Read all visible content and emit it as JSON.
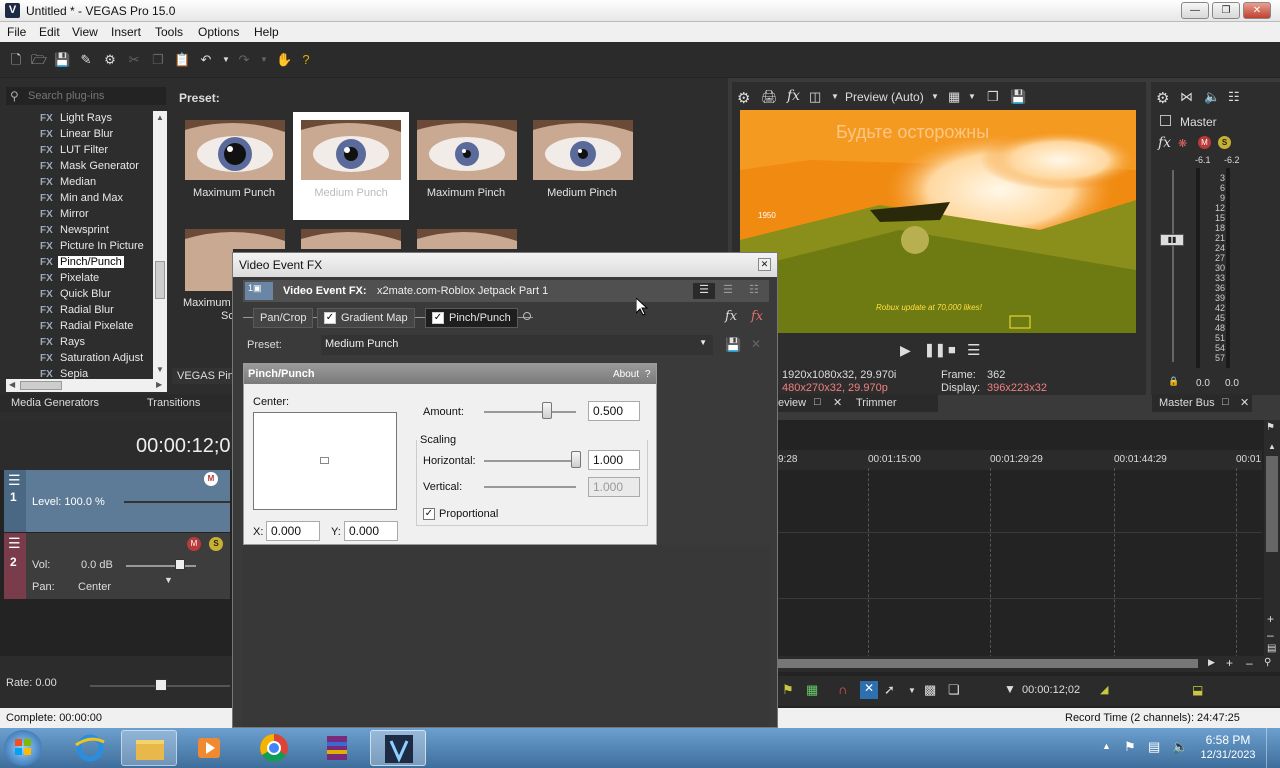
{
  "window": {
    "title": "Untitled * - VEGAS Pro 15.0",
    "logo": "V"
  },
  "menu": [
    "File",
    "Edit",
    "View",
    "Insert",
    "Tools",
    "Options",
    "Help"
  ],
  "plugins": {
    "search_placeholder": "Search plug-ins",
    "items": [
      "Light Rays",
      "Linear Blur",
      "LUT Filter",
      "Mask Generator",
      "Median",
      "Min and Max",
      "Mirror",
      "Newsprint",
      "Picture In Picture",
      "Pinch/Punch",
      "Pixelate",
      "Quick Blur",
      "Radial Blur",
      "Radial Pixelate",
      "Rays",
      "Saturation Adjust",
      "Sepia"
    ],
    "fx_badge": "FX",
    "selected": "Pinch/Punch"
  },
  "presets": {
    "header": "Preset:",
    "row1": [
      "Maximum Punch",
      "Medium Punch",
      "Maximum Pinch",
      "Medium Pinch"
    ],
    "row2_partial": [
      "Maximum",
      "Sc"
    ],
    "footer_tab": "VEGAS Pinc"
  },
  "left_tabs": [
    "Media Generators",
    "Transitions"
  ],
  "preview": {
    "mode": "Preview (Auto)",
    "project_info": "1920x1080x32, 29.970i",
    "preview_info": "480x270x32, 29.970p",
    "frame_label": "Frame:",
    "frame_value": "362",
    "display_label": "Display:",
    "display_value": "396x223x32",
    "overlay_text": "Будьте осторожны",
    "overlay_small": "1950",
    "overlay_bottom": "Robux update at 70,000 likes!",
    "tabs": [
      "eview",
      "Trimmer"
    ]
  },
  "master": {
    "title": "Master",
    "db_left": "-6.1",
    "db_right": "-6.2",
    "ticks": [
      "3",
      "6",
      "9",
      "12",
      "15",
      "18",
      "21",
      "24",
      "27",
      "30",
      "33",
      "36",
      "39",
      "42",
      "45",
      "48",
      "51",
      "54",
      "57"
    ],
    "bottom_left": "0.0",
    "bottom_right": "0.0",
    "tab": "Master Bus"
  },
  "timeline": {
    "timecode": "00:00:12;0",
    "ruler": [
      "9:28",
      "00:01:15:00",
      "00:01:29:29",
      "00:01:44:29",
      "00:01"
    ],
    "track1": {
      "number": "1",
      "level": "Level: 100.0 %"
    },
    "track2": {
      "number": "2",
      "vol_label": "Vol:",
      "vol_value": "0.0 dB",
      "pan_label": "Pan:",
      "pan_value": "Center"
    },
    "rate": "Rate: 0.00",
    "cursor_time": "00:00:12;02"
  },
  "status": {
    "complete": "Complete: 00:00:00",
    "record_time": "Record Time (2 channels): 24:47:25"
  },
  "dialog": {
    "title": "Video Event FX",
    "header_label": "Video Event FX:",
    "header_value": "x2mate.com-Roblox Jetpack Part 1",
    "chain": [
      "Pan/Crop",
      "Gradient Map",
      "Pinch/Punch"
    ],
    "preset_label": "Preset:",
    "preset_value": "Medium Punch",
    "plugin_title": "Pinch/Punch",
    "about": "About",
    "help": "?",
    "center_label": "Center:",
    "x_label": "X:",
    "x_value": "0.000",
    "y_label": "Y:",
    "y_value": "0.000",
    "amount_label": "Amount:",
    "amount_value": "0.500",
    "amount_level": 0.69,
    "scaling_label": "Scaling",
    "horizontal_label": "Horizontal:",
    "horizontal_value": "1.000",
    "vertical_label": "Vertical:",
    "vertical_value": "1.000",
    "proportional_label": "Proportional"
  },
  "taskbar": {
    "time": "6:58 PM",
    "date": "12/31/2023"
  },
  "colors": {
    "accent_selection": "#ffffff",
    "video_track": "#5d7b96",
    "audio_track_marker": "#7a3b4a",
    "preview_orange": "#f08a10"
  }
}
